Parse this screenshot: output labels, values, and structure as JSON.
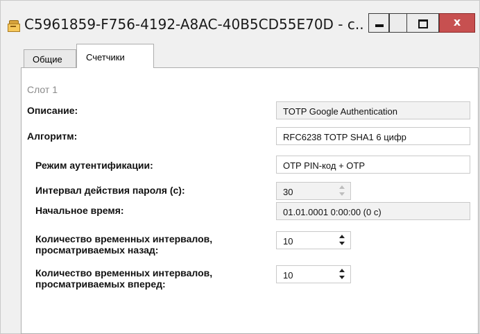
{
  "window": {
    "title": "C5961859-F756-4192-A8AC-40B5CD55E70D - c...",
    "buttons": {
      "minimize": "minimize-icon",
      "maximize": "maximize-icon",
      "close_glyph": "x"
    }
  },
  "tabs": [
    {
      "label": "Общие",
      "active": false
    },
    {
      "label": "Счетчики",
      "active": true
    }
  ],
  "form": {
    "slot_label": "Слот 1",
    "description": {
      "label": "Описание:",
      "value": "TOTP Google Authentication"
    },
    "algorithm": {
      "label": "Алгоритм:",
      "value": "RFC6238 TOTP SHA1 6 цифр"
    },
    "auth_mode": {
      "label": "Режим аутентификации:",
      "value": "OTP PIN-код + OTP"
    },
    "password_interval": {
      "label": "Интервал действия пароля (с):",
      "value": "30"
    },
    "start_time": {
      "label": "Начальное время:",
      "value": "01.01.0001 0:00:00 (0 с)"
    },
    "lookback": {
      "label": "Количество временных интервалов, просматриваемых назад:",
      "value": "10"
    },
    "lookahead": {
      "label": "Количество временных интервалов, просматриваемых вперед:",
      "value": "10"
    }
  },
  "colors": {
    "close_button": "#c75050",
    "panel_bg": "#ffffff",
    "window_bg": "#f0f0f0"
  }
}
